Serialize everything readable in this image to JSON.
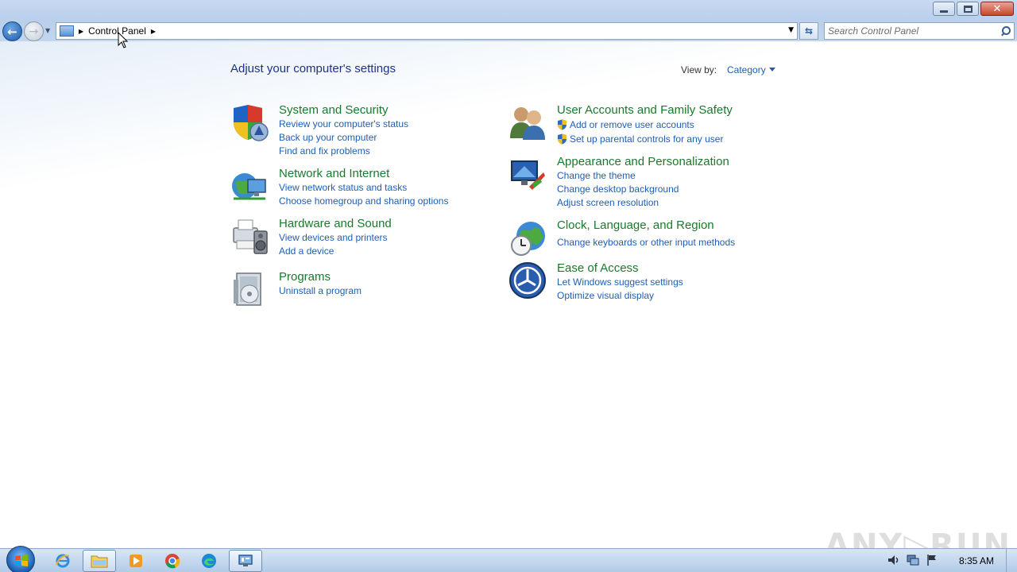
{
  "window": {
    "minimize_label": "",
    "maximize_label": "",
    "close_label": "✕"
  },
  "address_bar": {
    "breadcrumb": "Control Panel"
  },
  "search": {
    "placeholder": "Search Control Panel"
  },
  "header": {
    "title": "Adjust your computer's settings",
    "view_by_label": "View by:",
    "view_by_value": "Category"
  },
  "categories": [
    {
      "title": "System and Security",
      "icon": "shield-icon",
      "links": [
        "Review your computer's status",
        "Back up your computer",
        "Find and fix problems"
      ]
    },
    {
      "title": "Network and Internet",
      "icon": "network-globe-icon",
      "links": [
        "View network status and tasks",
        "Choose homegroup and sharing options"
      ]
    },
    {
      "title": "Hardware and Sound",
      "icon": "printer-speaker-icon",
      "links": [
        "View devices and printers",
        "Add a device"
      ]
    },
    {
      "title": "Programs",
      "icon": "programs-icon",
      "links": [
        "Uninstall a program"
      ]
    },
    {
      "title": "User Accounts and Family Safety",
      "icon": "users-icon",
      "links": [
        "Add or remove user accounts",
        "Set up parental controls for any user"
      ]
    },
    {
      "title": "Appearance and Personalization",
      "icon": "monitor-paint-icon",
      "links": [
        "Change the theme",
        "Change desktop background",
        "Adjust screen resolution"
      ]
    },
    {
      "title": "Clock, Language, and Region",
      "icon": "clock-globe-icon",
      "links": [
        "Change keyboards or other input methods"
      ]
    },
    {
      "title": "Ease of Access",
      "icon": "ease-of-access-icon",
      "links": [
        "Let Windows suggest settings",
        "Optimize visual display"
      ]
    }
  ],
  "watermark": "ANY▷RUN",
  "taskbar": {
    "items": [
      "internet-explorer-icon",
      "file-explorer-icon",
      "media-player-icon",
      "chrome-icon",
      "edge-icon",
      "control-panel-icon"
    ],
    "clock": "8:35 AM"
  }
}
